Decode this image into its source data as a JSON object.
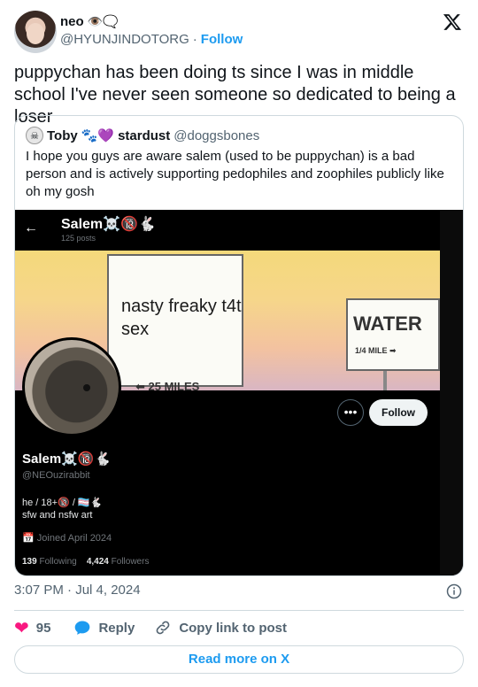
{
  "author": {
    "name": "neo",
    "emojis": "👁️🗨️",
    "handle": "@HYUNJINDOTORG",
    "separator": "·",
    "follow_label": "Follow"
  },
  "tweet_text": "puppychan has been doing ts since I was in middle school I've never seen someone so dedicated to being a loser",
  "quote": {
    "avatar_icon": "skull-avatar",
    "name": "Toby",
    "name_emojis": "🐾💜",
    "display_name": "stardust",
    "handle": "@doggsbones",
    "text": "I hope you guys are aware salem (used to be puppychan) is a bad person and is actively supporting pedophiles and zoophiles publicly like oh my gosh",
    "screenshot": {
      "title": "Salem☠️🔞🐇",
      "posts": "125 posts",
      "banner_sign": "nasty freaky t4t sex",
      "banner_arrow": "25 MILES",
      "banner_sign2": "WATER",
      "banner_sign2_sub": "1/4 MILE",
      "follow_label": "Follow",
      "more_label": "•••",
      "name": "Salem☠️🔞🐇",
      "handle": "@NEOuzirabbit",
      "bio_line1": "he / 18+🔞 / 🏳️‍⚧️🐇",
      "bio_line2": "sfw and nsfw art",
      "joined": "Joined April 2024",
      "following_count": "139",
      "following_label": "Following",
      "followers_count": "4,424",
      "followers_label": "Followers"
    }
  },
  "timestamp": "3:07 PM · Jul 4, 2024",
  "actions": {
    "like_count": "95",
    "reply_label": "Reply",
    "copy_label": "Copy link to post"
  },
  "read_more_label": "Read more on X",
  "colors": {
    "link_blue": "#1d9bf0",
    "like_pink": "#f91880",
    "muted": "#536471"
  }
}
